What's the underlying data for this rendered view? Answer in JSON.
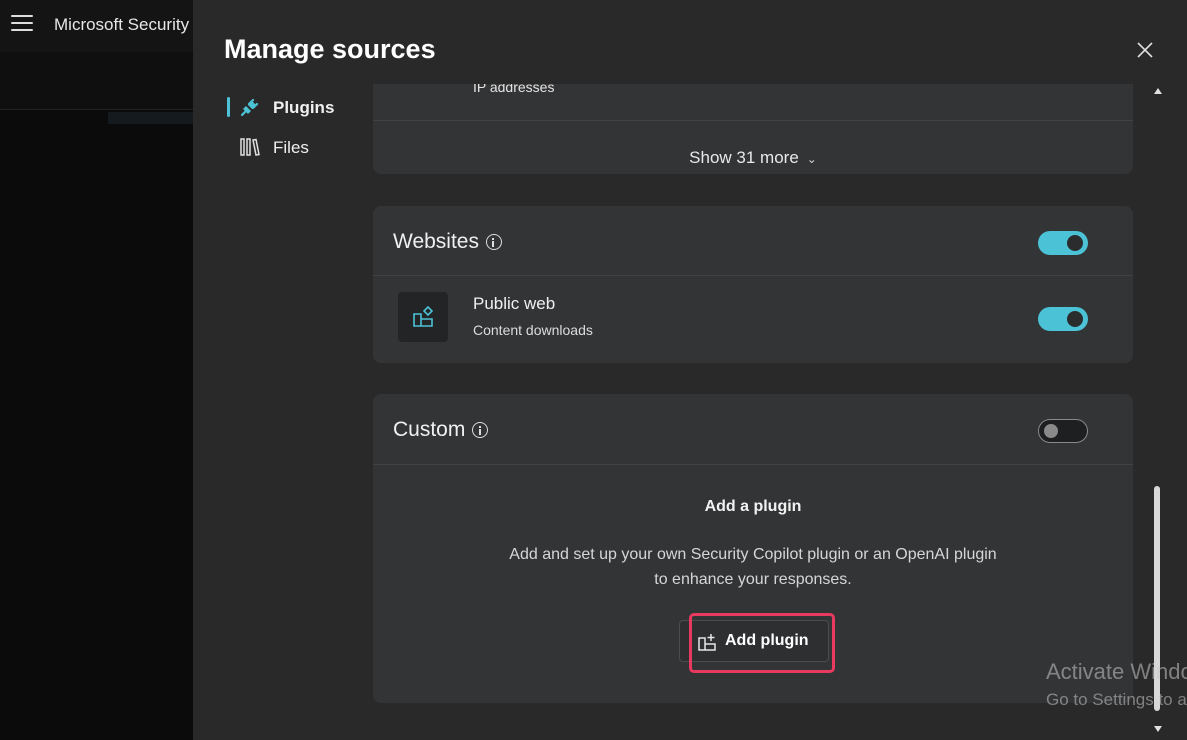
{
  "app": {
    "title": "Microsoft Security"
  },
  "dialog": {
    "title": "Manage sources"
  },
  "nav": [
    {
      "label": "Plugins",
      "icon": "plug-icon",
      "selected": true
    },
    {
      "label": "Files",
      "icon": "library-icon",
      "selected": false
    }
  ],
  "plugins_section": {
    "partial_item_subtitle": "IP addresses",
    "show_more": "Show 31 more"
  },
  "websites": {
    "title": "Websites",
    "enabled": true,
    "items": [
      {
        "title": "Public web",
        "subtitle": "Content downloads",
        "icon": "apps-add-icon",
        "enabled": true
      }
    ]
  },
  "custom": {
    "title": "Custom",
    "enabled": false,
    "empty_title": "Add a plugin",
    "empty_desc": "Add and set up your own Security Copilot plugin or an OpenAI plugin to enhance your responses.",
    "add_button": "Add plugin"
  },
  "watermark": {
    "line1": "Activate Windows",
    "line2": "Go to Settings to activate Windows."
  },
  "colors": {
    "accent": "#4cc2d6",
    "highlight": "#e8395e",
    "panel": "#292929",
    "card": "#323436"
  }
}
